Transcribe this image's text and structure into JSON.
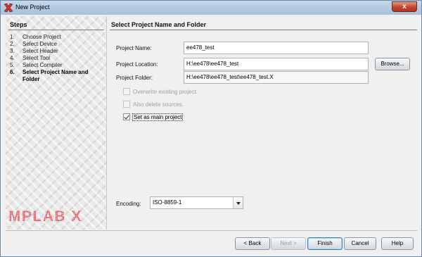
{
  "window": {
    "title": "New Project",
    "close_glyph": "x",
    "icon": "netbeans-x-icon"
  },
  "steps": {
    "heading": "Steps",
    "items": [
      {
        "num": "1.",
        "label": "Choose Project"
      },
      {
        "num": "2.",
        "label": "Select Device"
      },
      {
        "num": "3.",
        "label": "Select Header"
      },
      {
        "num": "4.",
        "label": "Select Tool"
      },
      {
        "num": "5.",
        "label": "Select Compiler"
      },
      {
        "num": "6.",
        "label": "Select Project Name and Folder"
      }
    ],
    "current_index": 5,
    "logo_text": "MPLAB X",
    "logo_color": "#e8202a"
  },
  "form": {
    "heading": "Select Project Name and Folder",
    "project_name": {
      "label": "Project Name:",
      "value": "ee478_test"
    },
    "project_location": {
      "label": "Project Location:",
      "value": "H:\\ee478\\ee478_test"
    },
    "browse_label": "Browse...",
    "project_folder": {
      "label": "Project Folder:",
      "value": "H:\\ee478\\ee478_test\\ee478_test.X"
    },
    "overwrite": {
      "label": "Overwrite existing project.",
      "checked": false,
      "enabled": false
    },
    "delete_sources": {
      "label": "Also delete sources.",
      "checked": false,
      "enabled": false
    },
    "main_project": {
      "label": "Set as main project",
      "checked": true,
      "enabled": true
    },
    "encoding": {
      "label": "Encoding:",
      "value": "ISO-8859-1"
    }
  },
  "buttons": {
    "back": "< Back",
    "next": "Next >",
    "finish": "Finish",
    "cancel": "Cancel",
    "help": "Help"
  }
}
